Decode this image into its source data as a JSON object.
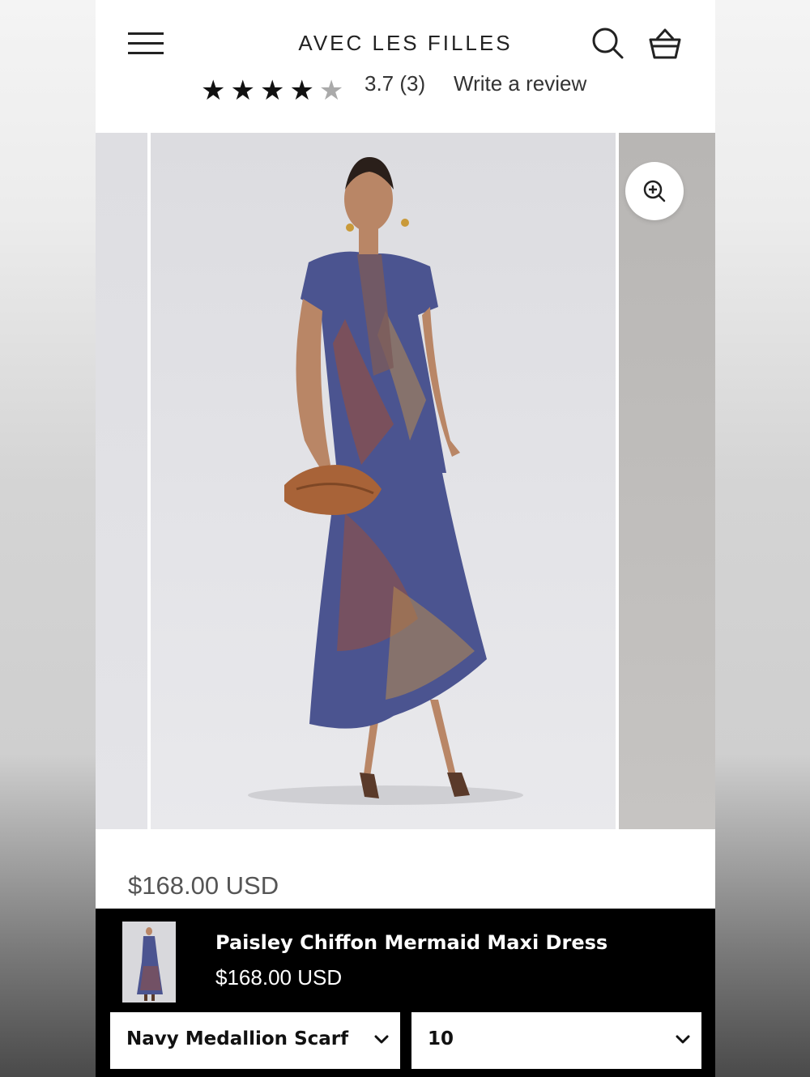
{
  "header": {
    "brand": "AVEC LES FILLES",
    "menu_icon": "hamburger-menu-icon",
    "search_icon": "search-icon",
    "cart_icon": "shopping-bag-icon"
  },
  "rating": {
    "stars_filled": 4,
    "stars_total": 5,
    "score_text": "3.7 (3)",
    "review_link": "Write a review"
  },
  "gallery": {
    "zoom_icon": "zoom-in-icon",
    "image_alt": "Model wearing paisley chiffon maxi dress holding brown clutch"
  },
  "product": {
    "price": "$168.00 USD"
  },
  "sticky_bar": {
    "title": "Paisley Chiffon Mermaid Maxi Dress",
    "price": "$168.00 USD",
    "color_select": "Navy Medallion Scarf",
    "size_select": "10"
  },
  "colors": {
    "dress_navy": "#4b5490",
    "dress_rust": "#9a4e3a",
    "bag_brown": "#a86338"
  }
}
